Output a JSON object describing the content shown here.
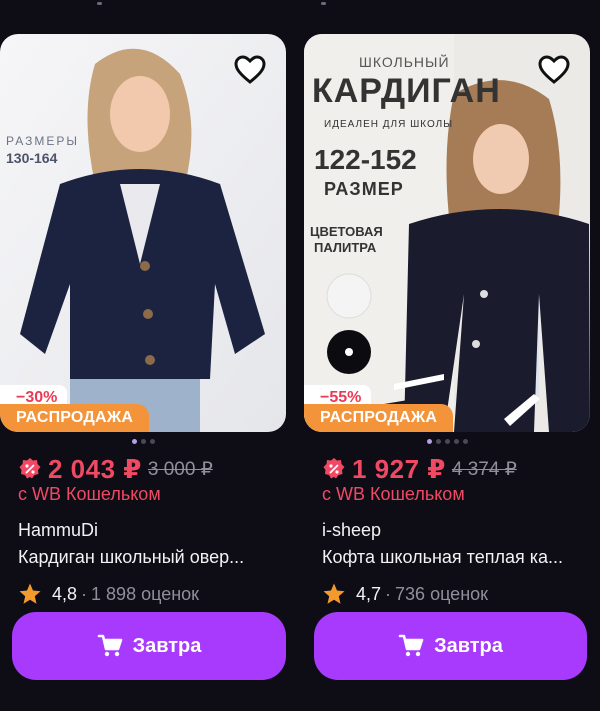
{
  "products": [
    {
      "discount": "−30%",
      "sale": "РАСПРОДАЖА",
      "price": "2 043 ₽",
      "old_price": "3 000 ₽",
      "wallet": "с WB Кошельком",
      "brand": "HammuDi",
      "title": "Кардиган школьный овер...",
      "rating": "4,8",
      "reviews": "1 898 оценок",
      "button": "Завтра",
      "image_overlay": {
        "line1": "РАЗМЕРЫ",
        "line2": "130-164"
      }
    },
    {
      "discount": "−55%",
      "sale": "РАСПРОДАЖА",
      "price": "1 927 ₽",
      "old_price": "4 374 ₽",
      "wallet": "с WB Кошельком",
      "brand": "i-sheep",
      "title": "Кофта школьная теплая ка...",
      "rating": "4,7",
      "reviews": "736 оценок",
      "button": "Завтра",
      "image_overlay": {
        "line1": "ШКОЛЬНЫЙ",
        "line2": "КАРДИГАН",
        "line3": "ИДЕАЛЕН ДЛЯ ШКОЛЫ",
        "line4": "122-152",
        "line5": "РАЗМЕР",
        "line6": "ЦВЕТОВАЯ",
        "line7": "ПАЛИТРА"
      }
    }
  ],
  "colors": {
    "accent": "#a73afd",
    "price": "#f04964",
    "sale": "#f4943a",
    "star": "#f39a2c"
  },
  "icons": [
    "heart-icon",
    "discount-icon",
    "star-icon",
    "cart-icon"
  ]
}
